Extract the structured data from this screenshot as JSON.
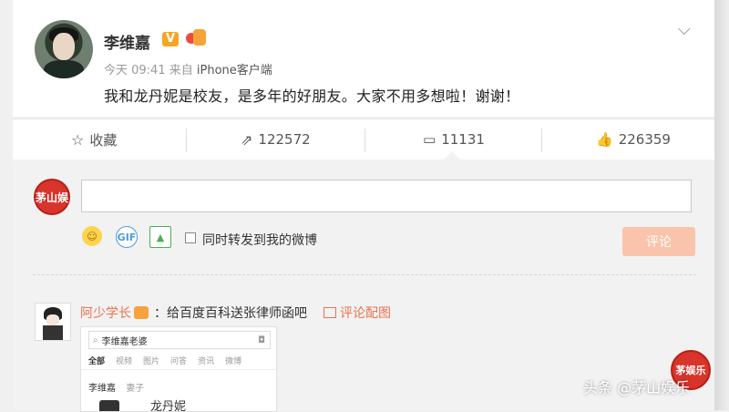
{
  "post": {
    "username": "李维嘉",
    "verified_badge": "V",
    "time": "今天 09:41",
    "source_prefix": "来自",
    "source": "iPhone客户端",
    "content": "我和龙丹妮是校友，是多年的好朋友。大家不用多想啦！谢谢！"
  },
  "actions": {
    "favorite_label": "收藏",
    "repost_count": "122572",
    "comment_count": "11131",
    "like_count": "226359"
  },
  "comment_box": {
    "stamp_text": "茅山娱",
    "emoji_icon": "smiley-icon",
    "gif_label": "GIF",
    "image_icon": "picture-icon",
    "forward_label": "同时转发到我的微博",
    "submit_label": "评论"
  },
  "comments": [
    {
      "user": "阿少学长",
      "text": "：给百度百科送张律师函吧",
      "pic_label": "评论配图"
    }
  ],
  "embedded_screenshot": {
    "search_text": "李维嘉老婆",
    "tabs": [
      "全部",
      "视频",
      "图片",
      "问答",
      "资讯",
      "微博"
    ],
    "row_name": "李维嘉",
    "row_sub": "妻子",
    "result_name": "龙丹妮"
  },
  "watermark": "头条 @茅山娱乐",
  "watermark_stamp": "茅娱乐",
  "colors": {
    "accent": "#eb7350",
    "badge_gold": "#f5a623",
    "submit_disabled": "#f9c4ab",
    "stamp_red": "#d9342b"
  }
}
